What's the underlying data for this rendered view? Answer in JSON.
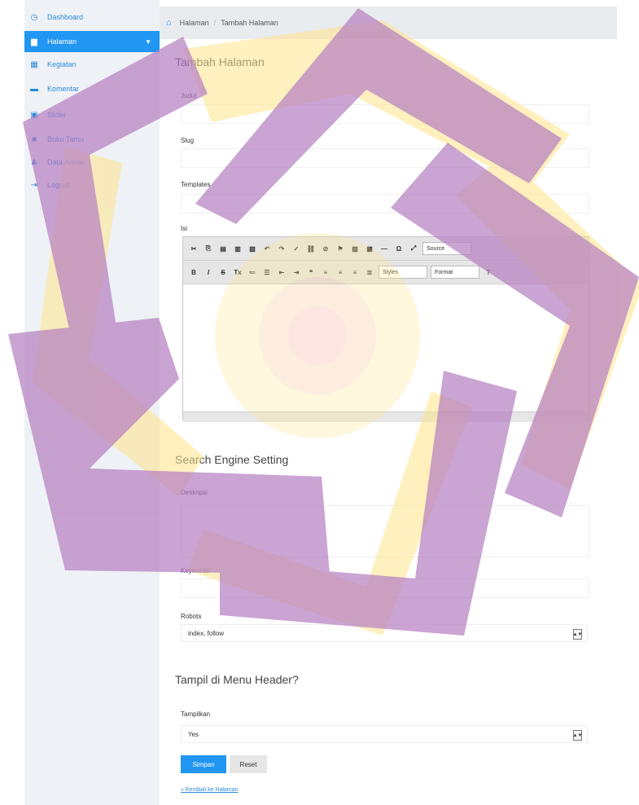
{
  "sidebar": {
    "items": [
      {
        "label": "Dashboard",
        "icon": "dashboard-icon"
      },
      {
        "label": "Halaman",
        "icon": "file-icon",
        "active": true
      },
      {
        "label": "Kegiatan",
        "icon": "calendar-icon"
      },
      {
        "label": "Komentar",
        "icon": "comment-icon"
      },
      {
        "label": "Slider",
        "icon": "image-icon"
      },
      {
        "label": "Buku Tamu",
        "icon": "book-icon"
      },
      {
        "label": "Data Admin",
        "icon": "user-icon"
      },
      {
        "label": "Logout",
        "icon": "logout-icon"
      }
    ]
  },
  "breadcrumb": {
    "items": [
      "Halaman",
      "Tambah Halaman"
    ]
  },
  "form": {
    "title": "Tambah Halaman",
    "judul_label": "Judul",
    "slug_label": "Slug",
    "templates_label": "Templates",
    "isi_label": "Isi",
    "editor": {
      "source_label": "Source",
      "styles_label": "Styles",
      "format_label": "Format"
    }
  },
  "seo": {
    "title": "Search Engine Setting",
    "deskripsi_label": "Deskripsi",
    "keywords_label": "Keywords",
    "robots_label": "Robots",
    "robots_value": "index, follow"
  },
  "menu_header": {
    "title": "Tampil di Menu Header?",
    "tampilkan_label": "Tampilkan",
    "tampilkan_value": "Yes"
  },
  "buttons": {
    "submit": "Simpan",
    "reset": "Reset"
  },
  "back_link": "« Kembali ke Halaman",
  "colors": {
    "accent": "#2196f3",
    "watermark_purple": "#b57ec0",
    "watermark_yellow": "#ffe48a",
    "watermark_orange": "#f7bf90"
  }
}
